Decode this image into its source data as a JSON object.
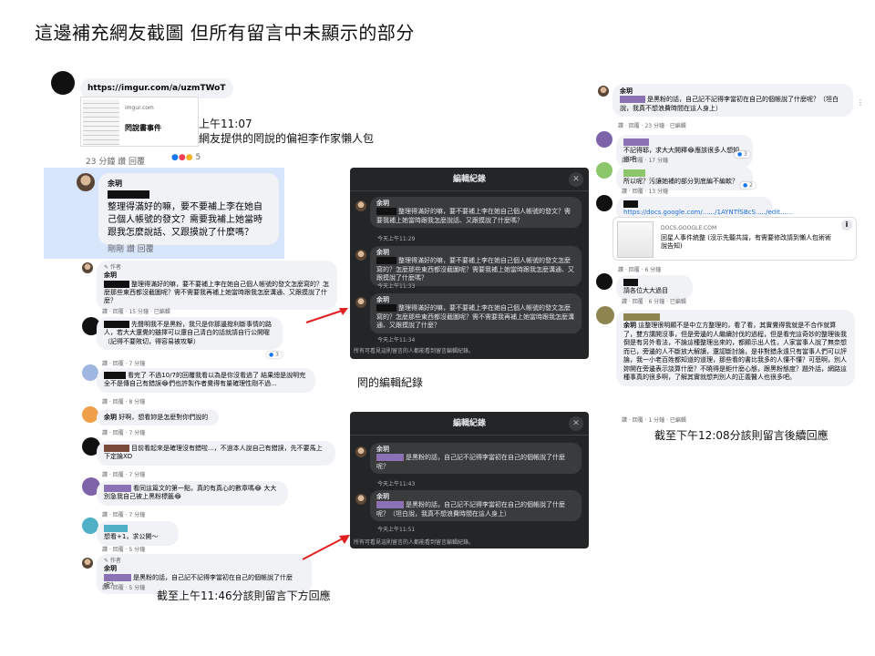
{
  "title": "這邊補充網友截圖 但所有留言中未顯示的部分",
  "left_top": {
    "link": "https://imgur.com/a/uzmTWoT",
    "card_domain": "imgur.com",
    "card_title": "罔說書事件",
    "meta": "23 分鐘   讚   回覆",
    "react_count": "5",
    "annotation_time": "上午11:07",
    "annotation_text": "網友提供的罔說的偏袒李作家懶人包"
  },
  "highlight": {
    "name": "余玥",
    "text": "整理得滿好的嘛，要不要補上李在她自己個人帳號的發文？需要我補上她當時跟我怎麼說話、又跟摸說了什麼嗎？",
    "actions": "剛剛   讚   回覆"
  },
  "left_comments": [
    {
      "author_tag": "✎ 作者",
      "name": "余玥",
      "text": "整理得滿好的嘛，要不要補上李在她自己個人帳號的發文怎麼寫的？怎麼那些東西都沒截圖呢？需不需要我再補上她當時跟我怎麼溝通、又跟摸說了什麼？",
      "meta": "讚 · 回覆 · 15 分鐘 · 已編輯"
    },
    {
      "text": "先聲明我不是黑粉，我只是你那邊撥利斷事情的路人，若大大還覺的雖擇可以還自己清白的話就請自行公開喔（記得不要敗切，得容易被攻擊）",
      "meta": "讚 · 回覆 · 7 分鐘",
      "react": "3"
    },
    {
      "text": "看完了 不過10/7的回覆我看以為是你沒看過了 結果總是說明完全不是傳自己有錯誤😂們也許製作者覺得有量確理性剛不過...",
      "meta": "讚 · 回覆 · 8 分鐘"
    },
    {
      "name": "余玥",
      "text": "好啊，想看妳是怎麼對你們說的",
      "meta": "讚 · 回覆 · 7 分鐘"
    },
    {
      "text": "目前看起來是確理沒有錯啦...，不過本人說自己有錯誤，先不要馬上下定論XD",
      "meta": "讚 · 回覆 · 7 分鐘"
    },
    {
      "text": "看同這篇文的第一點，真的有真心的數章嗎😂 大大別急我自己被上黑粉標籤😂",
      "meta": "讚 · 回覆 · 7 分鐘"
    },
    {
      "text": "想看+1，求公開～",
      "meta": "讚 · 回覆 · 5 分鐘"
    },
    {
      "author_tag": "✎ 作者",
      "name": "余玥",
      "text": "是黑粉的話，自己記不記得李當初在自己的個帳說了什麼呢？",
      "meta": "讚 · 回覆 · 5 分鐘"
    }
  ],
  "edit_history_1": {
    "header": "編輯紀錄",
    "entries": [
      {
        "name": "余玥",
        "text": "整理得滿好的嘛，要不要補上李在她自己個人帳號的發文？需要我補上她當時跟我怎麼說話、又跟摸說了什麼嗎？",
        "time": "今天上午11:29"
      },
      {
        "name": "余玥",
        "text": "整理得滿好的嘛，要不要補上李在她自己個人帳號的發文怎麼寫的？怎麼那些東西都沒截圖呢？需要我補上她當時跟我怎麼溝通、又跟摸說了什麼嗎？",
        "time": "今天上午11:33"
      },
      {
        "name": "余玥",
        "text": "整理得滿好的嘛，要不要補上李在她自己個人帳號的發文怎麼寫的？怎麼那些東西都沒截圖呢？需不需要我再補上她當時跟我怎麼溝通、又跟摸說了什麼？",
        "time": "今天上午11:34"
      }
    ],
    "footer": "所有可看見這則留言的人都能看到留言編輯紀錄。"
  },
  "edit_history_2": {
    "header": "編輯紀錄",
    "entries": [
      {
        "name": "余玥",
        "text": "是黑粉的話，自己記不記得李當初在自己的個帳說了什麼呢？",
        "time": "今天上午11:43"
      },
      {
        "name": "余玥",
        "text": "是黑粉的話，自己記不記得李當初在自己的個帳說了什麼呢？（坦白說，我真不想浪費時間在這人身上）",
        "time": "今天上午11:51"
      }
    ],
    "footer": "所有可看見這則留言的人都能看到留言編輯紀錄。"
  },
  "label_edit": "罔的編輯紀錄",
  "caption_left": "截至上午11:46分該則留言下方回應",
  "caption_right": "截至下午12:08分該則留言後續回應",
  "right_comments": [
    {
      "name": "余玥",
      "text": "是黑粉的話，自己記不記得李當初在自己的個帳說了什麼呢？（坦白說，我真不想浪費時間在這人身上）",
      "meta": "讚 · 回覆 · 23 分鐘 · 已編輯"
    },
    {
      "text": "不記得耶，求大大開釋😂應該很多人想知道吧",
      "meta": "讚 · 回覆 · 17 分鐘",
      "react": "3"
    },
    {
      "text": "所以呢？污讓她補的部分到底編不編軟？",
      "meta": "讚 · 回覆 · 13 分鐘",
      "react": "2"
    },
    {
      "text": "https://docs.google.com/....../1AYNTfSBcS...../edit......"
    },
    {
      "link_domain": "DOCS.GOOGLE.COM",
      "link_title": "回星人事件統整 (沒示先聽共識，有需要修改請到懶人包術術說告知)",
      "meta": "讚 · 回覆 · 6 分鐘"
    },
    {
      "text": "請各位大大過目",
      "meta": "讚 · 回覆 · 6 分鐘 · 已編輯"
    },
    {
      "name": "余玥",
      "text": "這整理很明顯不是中立方整理的，看了看，其實覺得我就是不合作就算了，雙方講開沒事，但是旁邊的人繼續討伐的過程，但是看完這奇妙的整理後我倒是有另外看法，不論這種整理出來的，都顯示出人性，人家當事人說了無奈想而已，旁邊的人不斷放大解讀，還認斷討論，是非對錯永遠只有當事人們可以評論，我一小老百姓都知道的道理，那些看的書比我多的人懂不懂？可悲啊，別人妳開在旁邊表示談算什麼？不曉得是鉅什麼心態，跟黑粉態度？題外話，網路這種事真的很多啊，了解其實就想判別人的正義醫人也很多吧。",
      "meta": "讚 · 回覆 · 1 分鐘 · 已編輯"
    }
  ]
}
